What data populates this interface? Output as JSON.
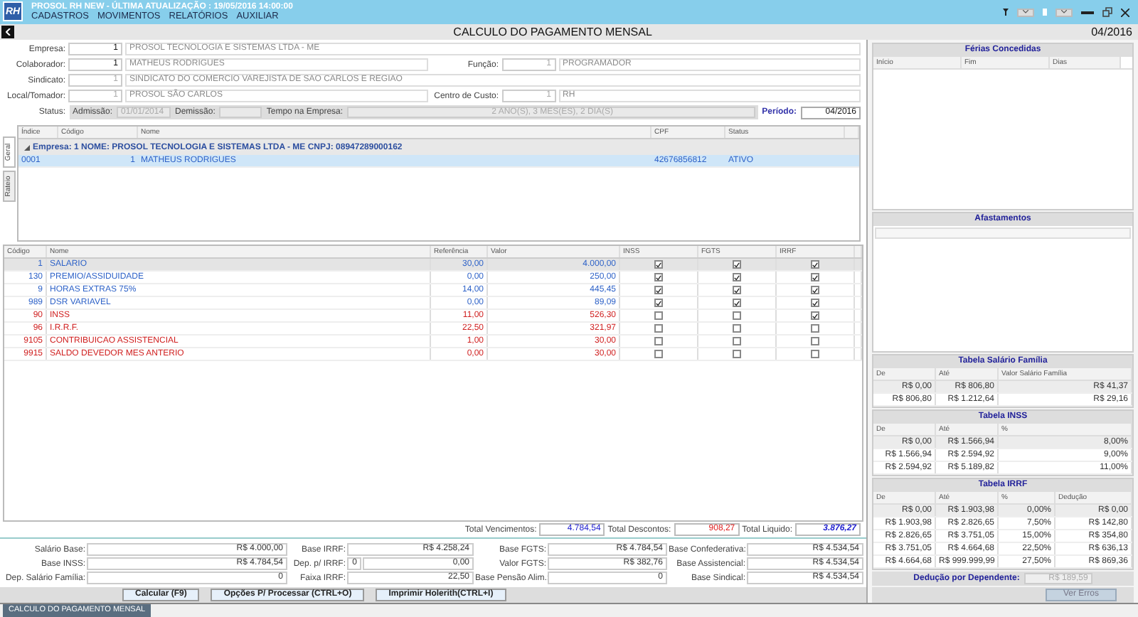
{
  "window": {
    "logo": "RH",
    "title": "PROSOL RH NEW - ÚLTIMA ATUALIZAÇÃO : 19/05/2016  14:00:00",
    "menu": [
      "CADASTROS",
      "MOVIMENTOS",
      "RELATÓRIOS",
      "AUXILIAR"
    ]
  },
  "header": {
    "title": "CALCULO DO PAGAMENTO MENSAL",
    "period": "04/2016"
  },
  "form": {
    "rows": [
      [
        {
          "label": "Empresa:",
          "code": "1",
          "value": "PROSOL TECNOLOGIA E SISTEMAS LTDA - ME",
          "disabled": false
        }
      ],
      [
        {
          "label": "Colaborador:",
          "code": "1",
          "value": "MATHEUS RODRIGUES",
          "disabled": false
        },
        {
          "label": "Função:",
          "code": "1",
          "value": "PROGRAMADOR",
          "disabled": true
        }
      ],
      [
        {
          "label": "Sindicato:",
          "code": "1",
          "value": "SINDICATO DO COMERCIO VAREJISTA DE SAO CARLOS E REGIAO",
          "disabled": true
        }
      ],
      [
        {
          "label": "Local/Tomador:",
          "code": "1",
          "value": "PROSOL SÃO CARLOS",
          "disabled": true
        },
        {
          "label": "Centro de Custo:",
          "code": "1",
          "value": "RH",
          "disabled": true
        }
      ]
    ],
    "status": {
      "label": "Status:",
      "admissao_label": "Admissão:",
      "admissao": "01/01/2014",
      "demissao_label": "Demissão:",
      "tempo_label": "Tempo na Empresa:",
      "tempo": "2 ANO(S), 3 MES(ES), 2 DIA(S)",
      "periodo_label": "Período:",
      "periodo": "04/2016"
    }
  },
  "employees": {
    "side_tabs": [
      {
        "label": "Geral",
        "selected": true
      },
      {
        "label": "Rateio",
        "selected": false
      }
    ],
    "columns": [
      "Índice",
      "Código",
      "Nome",
      "CPF",
      "Status"
    ],
    "group": {
      "text": "Empresa: 1 NOME: PROSOL TECNOLOGIA E SISTEMAS LTDA - ME  CNPJ: 08947289000162",
      "expanded": true
    },
    "rows": [
      {
        "indice": "0001",
        "codigo": "1",
        "nome": "MATHEUS RODRIGUES",
        "cpf": "42676856812",
        "status": "ATIVO",
        "selected": true
      }
    ]
  },
  "events": {
    "columns": [
      "Código",
      "Nome",
      "Referência",
      "Valor",
      "INSS",
      "FGTS",
      "IRRF"
    ],
    "rows": [
      {
        "kind": "provento",
        "codigo": "1",
        "nome": "SALARIO",
        "referencia": "30,00",
        "valor": "4.000,00",
        "inss": true,
        "fgts": true,
        "irrf": true,
        "selected": true
      },
      {
        "kind": "provento",
        "codigo": "130",
        "nome": "PREMIO/ASSIDUIDADE",
        "referencia": "0,00",
        "valor": "250,00",
        "inss": true,
        "fgts": true,
        "irrf": true,
        "selected": false
      },
      {
        "kind": "provento",
        "codigo": "9",
        "nome": "HORAS EXTRAS 75%",
        "referencia": "14,00",
        "valor": "445,45",
        "inss": true,
        "fgts": true,
        "irrf": true,
        "selected": false
      },
      {
        "kind": "provento",
        "codigo": "989",
        "nome": "DSR VARIAVEL",
        "referencia": "0,00",
        "valor": "89,09",
        "inss": true,
        "fgts": true,
        "irrf": true,
        "selected": false
      },
      {
        "kind": "desconto",
        "codigo": "90",
        "nome": "INSS",
        "referencia": "11,00",
        "valor": "526,30",
        "inss": false,
        "fgts": false,
        "irrf": true,
        "selected": false
      },
      {
        "kind": "desconto",
        "codigo": "96",
        "nome": "I.R.R.F.",
        "referencia": "22,50",
        "valor": "321,97",
        "inss": false,
        "fgts": false,
        "irrf": false,
        "selected": false
      },
      {
        "kind": "desconto",
        "codigo": "9105",
        "nome": "CONTRIBUICAO ASSISTENCIAL",
        "referencia": "1,00",
        "valor": "30,00",
        "inss": false,
        "fgts": false,
        "irrf": false,
        "selected": false
      },
      {
        "kind": "desconto",
        "codigo": "9915",
        "nome": "SALDO DEVEDOR MES ANTERIO",
        "referencia": "0,00",
        "valor": "30,00",
        "inss": false,
        "fgts": false,
        "irrf": false,
        "selected": false
      }
    ]
  },
  "totals": [
    {
      "kind": "vencimentos",
      "label": "Total Vencimentos:",
      "value": "4.784,54"
    },
    {
      "kind": "descontos",
      "label": "Total Descontos:",
      "value": "908,27"
    },
    {
      "kind": "liquido",
      "label": "Total Liquido:",
      "value": "3.876,27"
    }
  ],
  "bases": [
    [
      {
        "label": "Salário Base:",
        "values": [
          "R$ 4.000,00"
        ]
      },
      {
        "label": "Base IRRF:",
        "values": [
          "R$ 4.258,24"
        ]
      },
      {
        "label": "Base FGTS:",
        "values": [
          "R$ 4.784,54"
        ]
      },
      {
        "label": "Base Confederativa:",
        "values": [
          "R$ 4.534,54"
        ]
      }
    ],
    [
      {
        "label": "Base INSS:",
        "values": [
          "R$ 4.784,54"
        ]
      },
      {
        "label": "Dep. p/ IRRF:",
        "values": [
          "0",
          "0,00"
        ]
      },
      {
        "label": "Valor FGTS:",
        "values": [
          "R$ 382,76"
        ]
      },
      {
        "label": "Base Assistencial:",
        "values": [
          "R$ 4.534,54"
        ]
      }
    ],
    [
      {
        "label": "Dep. Salário Família:",
        "values": [
          "0"
        ]
      },
      {
        "label": "Faixa IRRF:",
        "values": [
          "22,50"
        ]
      },
      {
        "label": "Base Pensão Alim.:",
        "values": [
          "0"
        ]
      },
      {
        "label": "Base Sindical:",
        "values": [
          "R$ 4.534,54"
        ]
      }
    ]
  ],
  "buttons": [
    "Calcular (F9)",
    "Opções P/ Processar (CTRL+O)",
    "Imprimir Holerith(CTRL+I)"
  ],
  "bottom_tabs": [
    {
      "label": "CALCULO DO PAGAMENTO MENSAL",
      "selected": true
    }
  ],
  "right": {
    "ferias": {
      "title": "Férias Concedidas",
      "columns": [
        "Início",
        "Fim",
        "Dias"
      ]
    },
    "afastamentos": {
      "title": "Afastamentos"
    },
    "salario_familia": {
      "title": "Tabela Salário Família",
      "columns": [
        "De",
        "Até",
        "Valor Salário Família"
      ],
      "rows": [
        [
          "R$ 0,00",
          "R$ 806,80",
          "R$ 41,37"
        ],
        [
          "R$ 806,80",
          "R$ 1.212,64",
          "R$ 29,16"
        ]
      ]
    },
    "inss": {
      "title": "Tabela INSS",
      "columns": [
        "De",
        "Até",
        "%"
      ],
      "rows": [
        [
          "R$ 0,00",
          "R$ 1.566,94",
          "8,00%"
        ],
        [
          "R$ 1.566,94",
          "R$ 2.594,92",
          "9,00%"
        ],
        [
          "R$ 2.594,92",
          "R$ 5.189,82",
          "11,00%"
        ]
      ]
    },
    "irrf": {
      "title": "Tabela IRRF",
      "columns": [
        "De",
        "Até",
        "%",
        "Dedução"
      ],
      "rows": [
        [
          "R$ 0,00",
          "R$ 1.903,98",
          "0,00%",
          "R$ 0,00"
        ],
        [
          "R$ 1.903,98",
          "R$ 2.826,65",
          "7,50%",
          "R$ 142,80"
        ],
        [
          "R$ 2.826,65",
          "R$ 3.751,05",
          "15,00%",
          "R$ 354,80"
        ],
        [
          "R$ 3.751,05",
          "R$ 4.664,68",
          "22,50%",
          "R$ 636,13"
        ],
        [
          "R$ 4.664,68",
          "R$ 999.999,99",
          "27,50%",
          "R$ 869,36"
        ]
      ]
    },
    "deducao": {
      "label": "Dedução por Dependente:",
      "value": "R$ 189,59"
    },
    "ver_erros": "Ver Erros"
  }
}
